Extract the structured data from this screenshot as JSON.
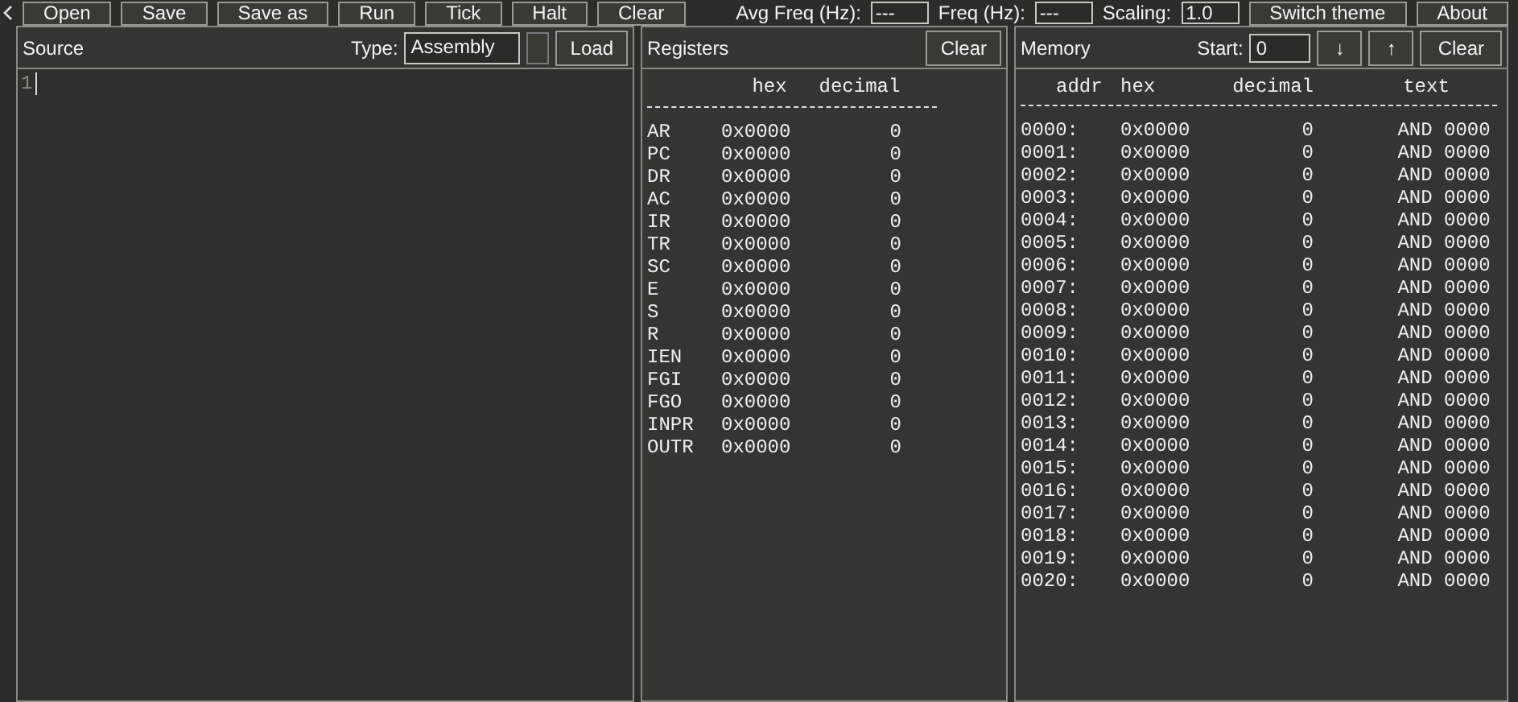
{
  "toolbar": {
    "buttons": [
      "Open",
      "Save",
      "Save as",
      "Run",
      "Tick",
      "Halt",
      "Clear"
    ],
    "avg_freq": {
      "label": "Avg Freq (Hz):",
      "value": "---"
    },
    "freq": {
      "label": "Freq (Hz):",
      "value": "---"
    },
    "scaling": {
      "label": "Scaling:",
      "value": "1.0"
    },
    "buttons_right": [
      "Switch theme",
      "About"
    ]
  },
  "source": {
    "title": "Source",
    "type_label": "Type:",
    "type_value": "Assembly",
    "load_button": "Load",
    "line_numbers": [
      "1"
    ]
  },
  "registers": {
    "title": "Registers",
    "clear_button": "Clear",
    "columns": [
      "hex",
      "decimal"
    ],
    "rows": [
      {
        "name": "AR",
        "hex": "0x0000",
        "decimal": "0"
      },
      {
        "name": "PC",
        "hex": "0x0000",
        "decimal": "0"
      },
      {
        "name": "DR",
        "hex": "0x0000",
        "decimal": "0"
      },
      {
        "name": "AC",
        "hex": "0x0000",
        "decimal": "0"
      },
      {
        "name": "IR",
        "hex": "0x0000",
        "decimal": "0"
      },
      {
        "name": "TR",
        "hex": "0x0000",
        "decimal": "0"
      },
      {
        "name": "SC",
        "hex": "0x0000",
        "decimal": "0"
      },
      {
        "name": "E",
        "hex": "0x0000",
        "decimal": "0"
      },
      {
        "name": "S",
        "hex": "0x0000",
        "decimal": "0"
      },
      {
        "name": "R",
        "hex": "0x0000",
        "decimal": "0"
      },
      {
        "name": "IEN",
        "hex": "0x0000",
        "decimal": "0"
      },
      {
        "name": "FGI",
        "hex": "0x0000",
        "decimal": "0"
      },
      {
        "name": "FGO",
        "hex": "0x0000",
        "decimal": "0"
      },
      {
        "name": "INPR",
        "hex": "0x0000",
        "decimal": "0"
      },
      {
        "name": "OUTR",
        "hex": "0x0000",
        "decimal": "0"
      }
    ]
  },
  "memory": {
    "title": "Memory",
    "start_label": "Start:",
    "start_value": "0",
    "down_button": "↓",
    "up_button": "↑",
    "clear_button": "Clear",
    "columns": [
      "addr",
      "hex",
      "decimal",
      "text"
    ],
    "rows": [
      {
        "addr": "0000:",
        "hex": "0x0000",
        "decimal": "0",
        "text": "AND 0000"
      },
      {
        "addr": "0001:",
        "hex": "0x0000",
        "decimal": "0",
        "text": "AND 0000"
      },
      {
        "addr": "0002:",
        "hex": "0x0000",
        "decimal": "0",
        "text": "AND 0000"
      },
      {
        "addr": "0003:",
        "hex": "0x0000",
        "decimal": "0",
        "text": "AND 0000"
      },
      {
        "addr": "0004:",
        "hex": "0x0000",
        "decimal": "0",
        "text": "AND 0000"
      },
      {
        "addr": "0005:",
        "hex": "0x0000",
        "decimal": "0",
        "text": "AND 0000"
      },
      {
        "addr": "0006:",
        "hex": "0x0000",
        "decimal": "0",
        "text": "AND 0000"
      },
      {
        "addr": "0007:",
        "hex": "0x0000",
        "decimal": "0",
        "text": "AND 0000"
      },
      {
        "addr": "0008:",
        "hex": "0x0000",
        "decimal": "0",
        "text": "AND 0000"
      },
      {
        "addr": "0009:",
        "hex": "0x0000",
        "decimal": "0",
        "text": "AND 0000"
      },
      {
        "addr": "0010:",
        "hex": "0x0000",
        "decimal": "0",
        "text": "AND 0000"
      },
      {
        "addr": "0011:",
        "hex": "0x0000",
        "decimal": "0",
        "text": "AND 0000"
      },
      {
        "addr": "0012:",
        "hex": "0x0000",
        "decimal": "0",
        "text": "AND 0000"
      },
      {
        "addr": "0013:",
        "hex": "0x0000",
        "decimal": "0",
        "text": "AND 0000"
      },
      {
        "addr": "0014:",
        "hex": "0x0000",
        "decimal": "0",
        "text": "AND 0000"
      },
      {
        "addr": "0015:",
        "hex": "0x0000",
        "decimal": "0",
        "text": "AND 0000"
      },
      {
        "addr": "0016:",
        "hex": "0x0000",
        "decimal": "0",
        "text": "AND 0000"
      },
      {
        "addr": "0017:",
        "hex": "0x0000",
        "decimal": "0",
        "text": "AND 0000"
      },
      {
        "addr": "0018:",
        "hex": "0x0000",
        "decimal": "0",
        "text": "AND 0000"
      },
      {
        "addr": "0019:",
        "hex": "0x0000",
        "decimal": "0",
        "text": "AND 0000"
      },
      {
        "addr": "0020:",
        "hex": "0x0000",
        "decimal": "0",
        "text": "AND 0000"
      }
    ]
  }
}
